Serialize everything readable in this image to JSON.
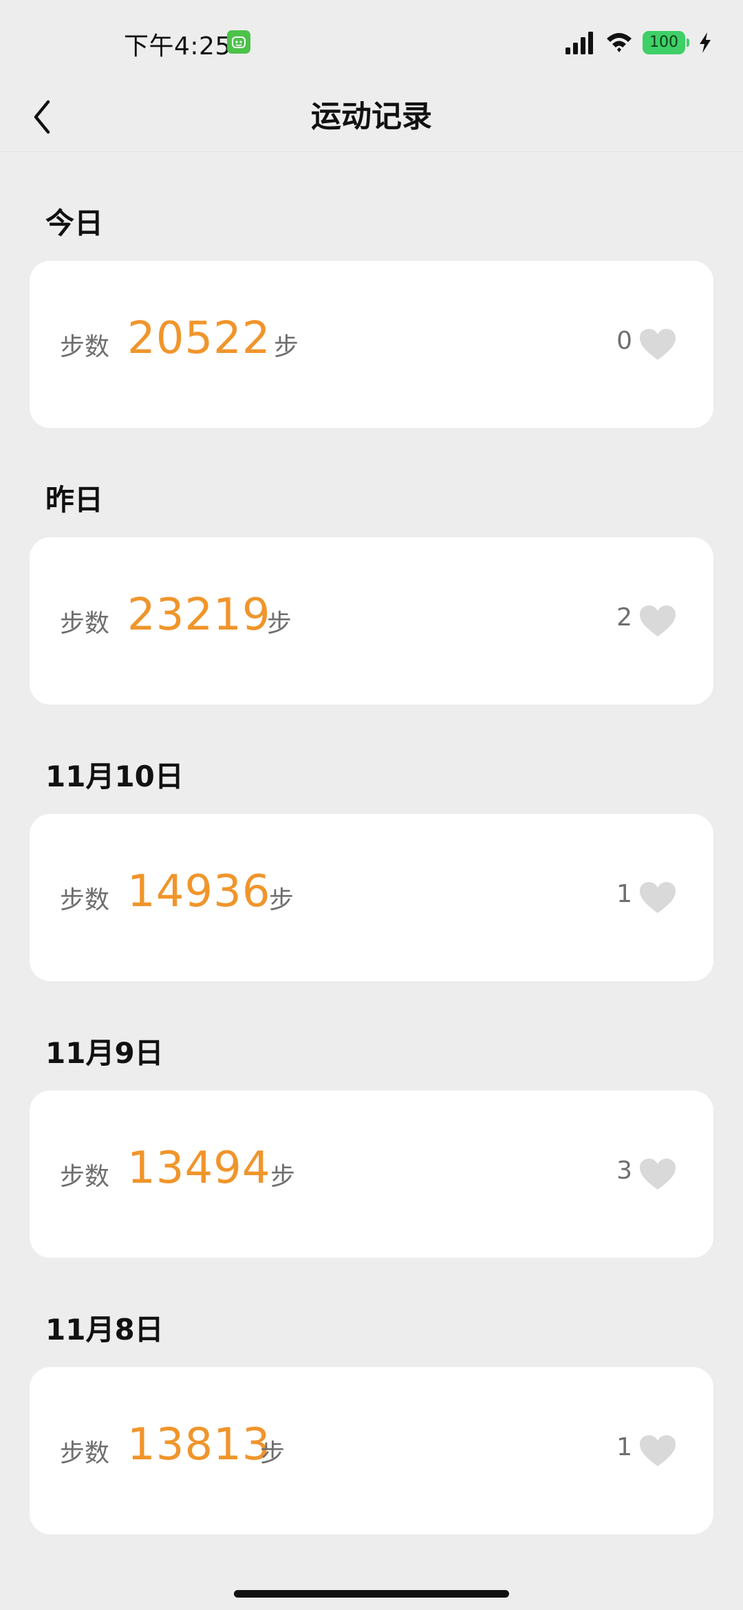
{
  "status_bar": {
    "time": "下午4:25",
    "battery": "100"
  },
  "nav": {
    "title": "运动记录"
  },
  "records": [
    {
      "date": "今日",
      "label": "步数",
      "steps": "20522",
      "unit": "步",
      "likes": "0"
    },
    {
      "date": "昨日",
      "label": "步数",
      "steps": "23219",
      "unit": "步",
      "likes": "2"
    },
    {
      "date": "11月10日",
      "label": "步数",
      "steps": "14936",
      "unit": "步",
      "likes": "1"
    },
    {
      "date": "11月9日",
      "label": "步数",
      "steps": "13494",
      "unit": "步",
      "likes": "3"
    },
    {
      "date": "11月8日",
      "label": "步数",
      "steps": "13813",
      "unit": "步",
      "likes": "1"
    }
  ],
  "colors": {
    "accent": "#f0952b",
    "background": "#ededed",
    "card": "#ffffff",
    "heart": "#d9d9d9",
    "battery": "#3fcf67"
  },
  "icons": {
    "back": "chevron-left-icon",
    "heart": "heart-icon",
    "signal": "signal-icon",
    "wifi": "wifi-icon",
    "charging": "bolt-icon"
  }
}
